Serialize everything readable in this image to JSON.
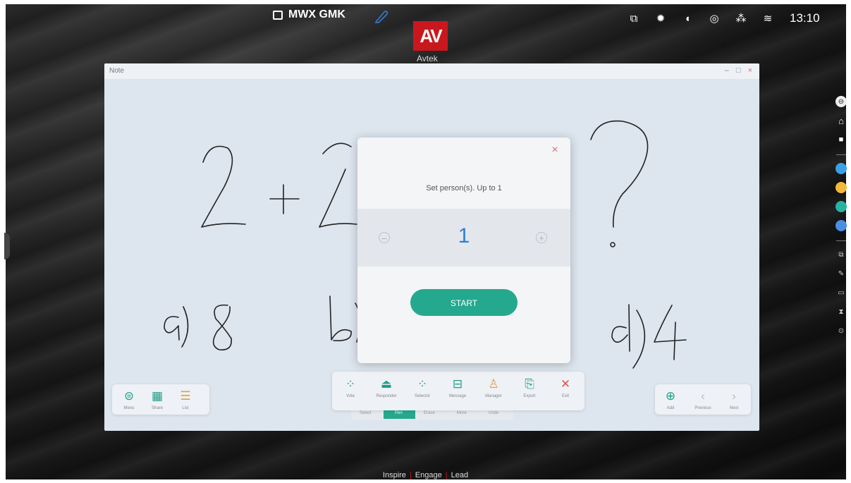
{
  "status_bar": {
    "host_name": "MWX GMK",
    "time": "13:10",
    "logo_text": "AV",
    "logo_sub": "Avtek"
  },
  "note_window": {
    "title": "Note",
    "controls": [
      "–",
      "□",
      "×"
    ]
  },
  "dialog": {
    "message": "Set person(s). Up to 1",
    "value": "1",
    "minus": "–",
    "plus": "+",
    "close": "×",
    "start_label": "START"
  },
  "left_toolbar": [
    {
      "label": "Menu",
      "icon": "menu-icon",
      "glyph": "⊜"
    },
    {
      "label": "Share",
      "icon": "qr-icon",
      "glyph": "▦"
    },
    {
      "label": "List",
      "icon": "list-icon",
      "glyph": "☰"
    }
  ],
  "center_toolbar": [
    {
      "label": "Vote",
      "icon": "vote-icon",
      "glyph": "⁘"
    },
    {
      "label": "Responder",
      "icon": "responder-icon",
      "glyph": "⏏"
    },
    {
      "label": "Selector",
      "icon": "selector-icon",
      "glyph": "⁘"
    },
    {
      "label": "Message",
      "icon": "message-icon",
      "glyph": "⊟"
    },
    {
      "label": "Manager",
      "icon": "manager-icon",
      "glyph": "♙"
    },
    {
      "label": "Export",
      "icon": "export-icon",
      "glyph": "⎘"
    },
    {
      "label": "Exit",
      "icon": "exit-icon",
      "glyph": "✕"
    }
  ],
  "back_toolbar": [
    "Select",
    "Pen",
    "Erase",
    "More",
    "Undo"
  ],
  "right_toolbar": [
    {
      "label": "Add",
      "icon": "add-page-icon",
      "glyph": "⊕"
    },
    {
      "label": "Previous",
      "icon": "previous-icon",
      "glyph": "‹"
    },
    {
      "label": "Next",
      "icon": "next-icon",
      "glyph": "›"
    }
  ],
  "tagline": {
    "a": "Inspire",
    "b": "Engage",
    "c": "Lead"
  },
  "colors": {
    "accent": "#24a98e",
    "value_blue": "#2f7fd3",
    "close_red": "#e26a6a",
    "logo_red": "#c8181e"
  }
}
